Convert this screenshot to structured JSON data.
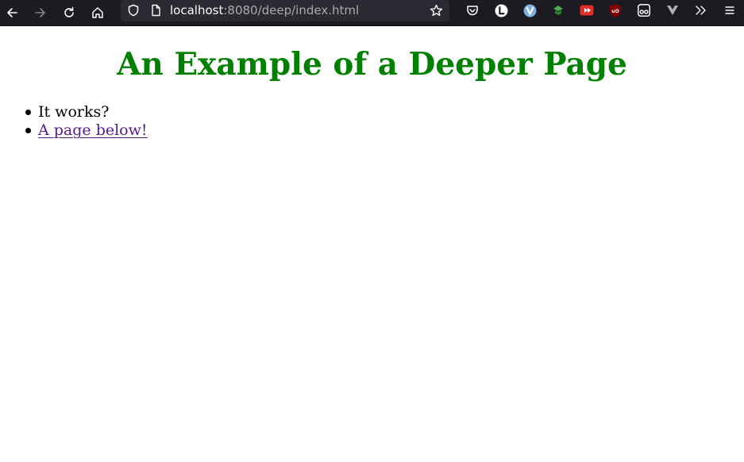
{
  "browser": {
    "url": {
      "host": "localhost",
      "rest": ":8080/deep/index.html"
    },
    "extensions": [
      "pocket-icon",
      "l-extension-icon",
      "vivaldi-like-icon",
      "green-shield-icon",
      "youtube-extension-icon",
      "ublock-origin-icon",
      "tampermonkey-icon",
      "v-extension-icon"
    ],
    "colors": {
      "toolbar_bg": "#1c1b22",
      "urlbar_bg": "#2b2a33"
    }
  },
  "page": {
    "title": "An Example of a Deeper Page",
    "title_color": "#008000",
    "items": [
      {
        "text": "It works?"
      },
      {
        "link_text": "A page below!",
        "link_color": "#551a8b"
      }
    ]
  }
}
